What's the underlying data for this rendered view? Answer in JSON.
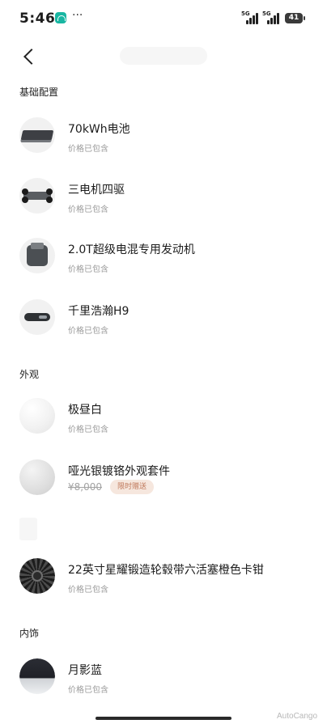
{
  "status_bar": {
    "time": "5:46",
    "signal_label_1": "5G",
    "signal_label_2": "5G",
    "battery": "41"
  },
  "nav": {
    "back_icon": "chevron-left-icon"
  },
  "sections": {
    "basic": "基础配置",
    "exterior": "外观",
    "interior": "内饰"
  },
  "items": [
    {
      "name": "70kWh电池",
      "sub": "价格已包含"
    },
    {
      "name": "三电机四驱",
      "sub": "价格已包含"
    },
    {
      "name": "2.0T超级电混专用发动机",
      "sub": "价格已包含"
    },
    {
      "name": "千里浩瀚H9",
      "sub": "价格已包含"
    },
    {
      "name": "极昼白",
      "sub": "价格已包含"
    },
    {
      "name": "哑光银镀铬外观套件",
      "price": "¥8,000",
      "badge": "限时赠送"
    },
    {
      "name": "22英寸星耀锻造轮毂带六活塞橙色卡钳",
      "sub": "价格已包含"
    },
    {
      "name": "月影蓝",
      "sub": "价格已包含"
    }
  ],
  "colors": {
    "badge_bg": "#f6e7de",
    "badge_text": "#c07a5c",
    "app_icon": "#19b6a2"
  },
  "watermark": "AutoCango"
}
